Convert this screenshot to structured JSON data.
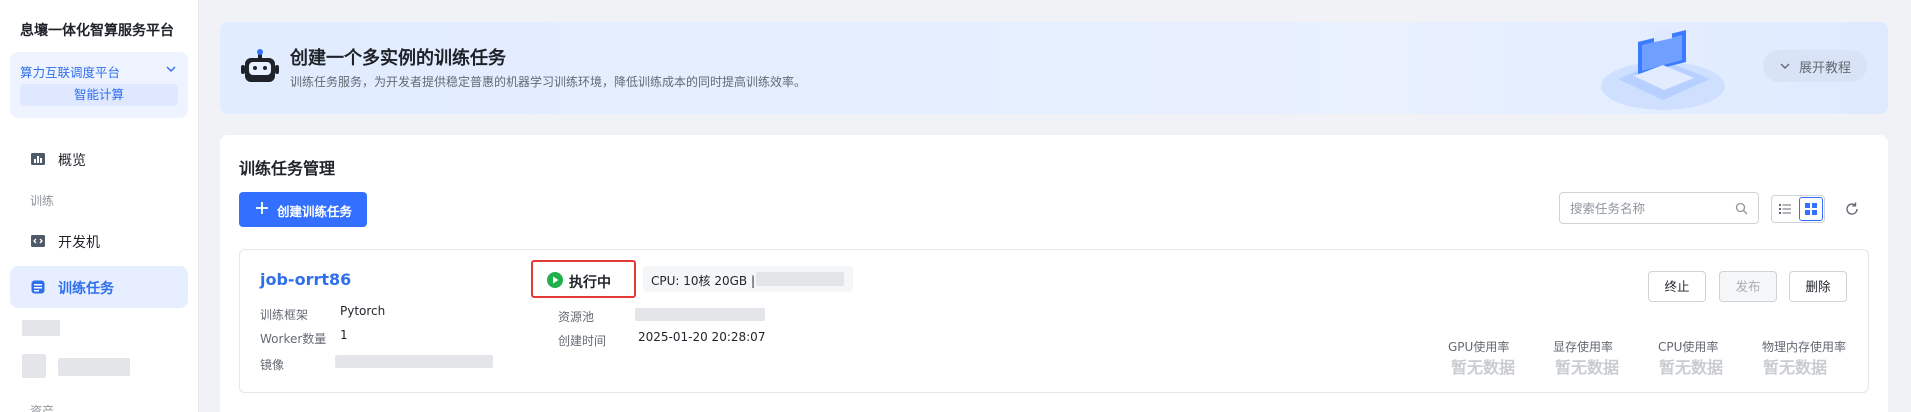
{
  "sidebar": {
    "brand": "息壤一体化智算服务平台",
    "platform": {
      "title": "算力互联调度平台",
      "chip": "智能计算"
    },
    "items": [
      {
        "label": "概览",
        "icon": "bar-chart-icon"
      },
      {
        "section": "训练"
      },
      {
        "label": "开发机",
        "icon": "code-window-icon"
      },
      {
        "label": "训练任务",
        "icon": "task-list-icon",
        "active": true
      }
    ],
    "bottom_section": "资产"
  },
  "banner": {
    "title": "创建一个多实例的训练任务",
    "description": "训练任务服务，为开发者提供稳定普惠的机器学习训练环境，降低训练成本的同时提高训练效率。",
    "expand_label": "展开教程"
  },
  "main": {
    "title": "训练任务管理",
    "create_button": "创建训练任务",
    "search_placeholder": "搜索任务名称"
  },
  "job": {
    "name": "job-orrt86",
    "fields": [
      {
        "key": "训练框架",
        "value": "Pytorch"
      },
      {
        "key": "Worker数量",
        "value": "1"
      },
      {
        "key": "镜像",
        "value": ""
      }
    ],
    "status": "执行中",
    "resource": "CPU: 10核 20GB |",
    "pool_label": "资源池",
    "created_label": "创建时间",
    "created_value": "2025-01-20 20:28:07",
    "actions": [
      {
        "label": "终止",
        "disabled": false
      },
      {
        "label": "发布",
        "disabled": true
      },
      {
        "label": "删除",
        "disabled": false
      }
    ],
    "metrics": [
      {
        "label": "GPU使用率",
        "value": "暂无数据"
      },
      {
        "label": "显存使用率",
        "value": "暂无数据"
      },
      {
        "label": "CPU使用率",
        "value": "暂无数据"
      },
      {
        "label": "物理内存使用率",
        "value": "暂无数据"
      }
    ]
  },
  "colors": {
    "primary": "#3370ff",
    "status_running": "#22b04c",
    "highlight": "#e53935"
  }
}
